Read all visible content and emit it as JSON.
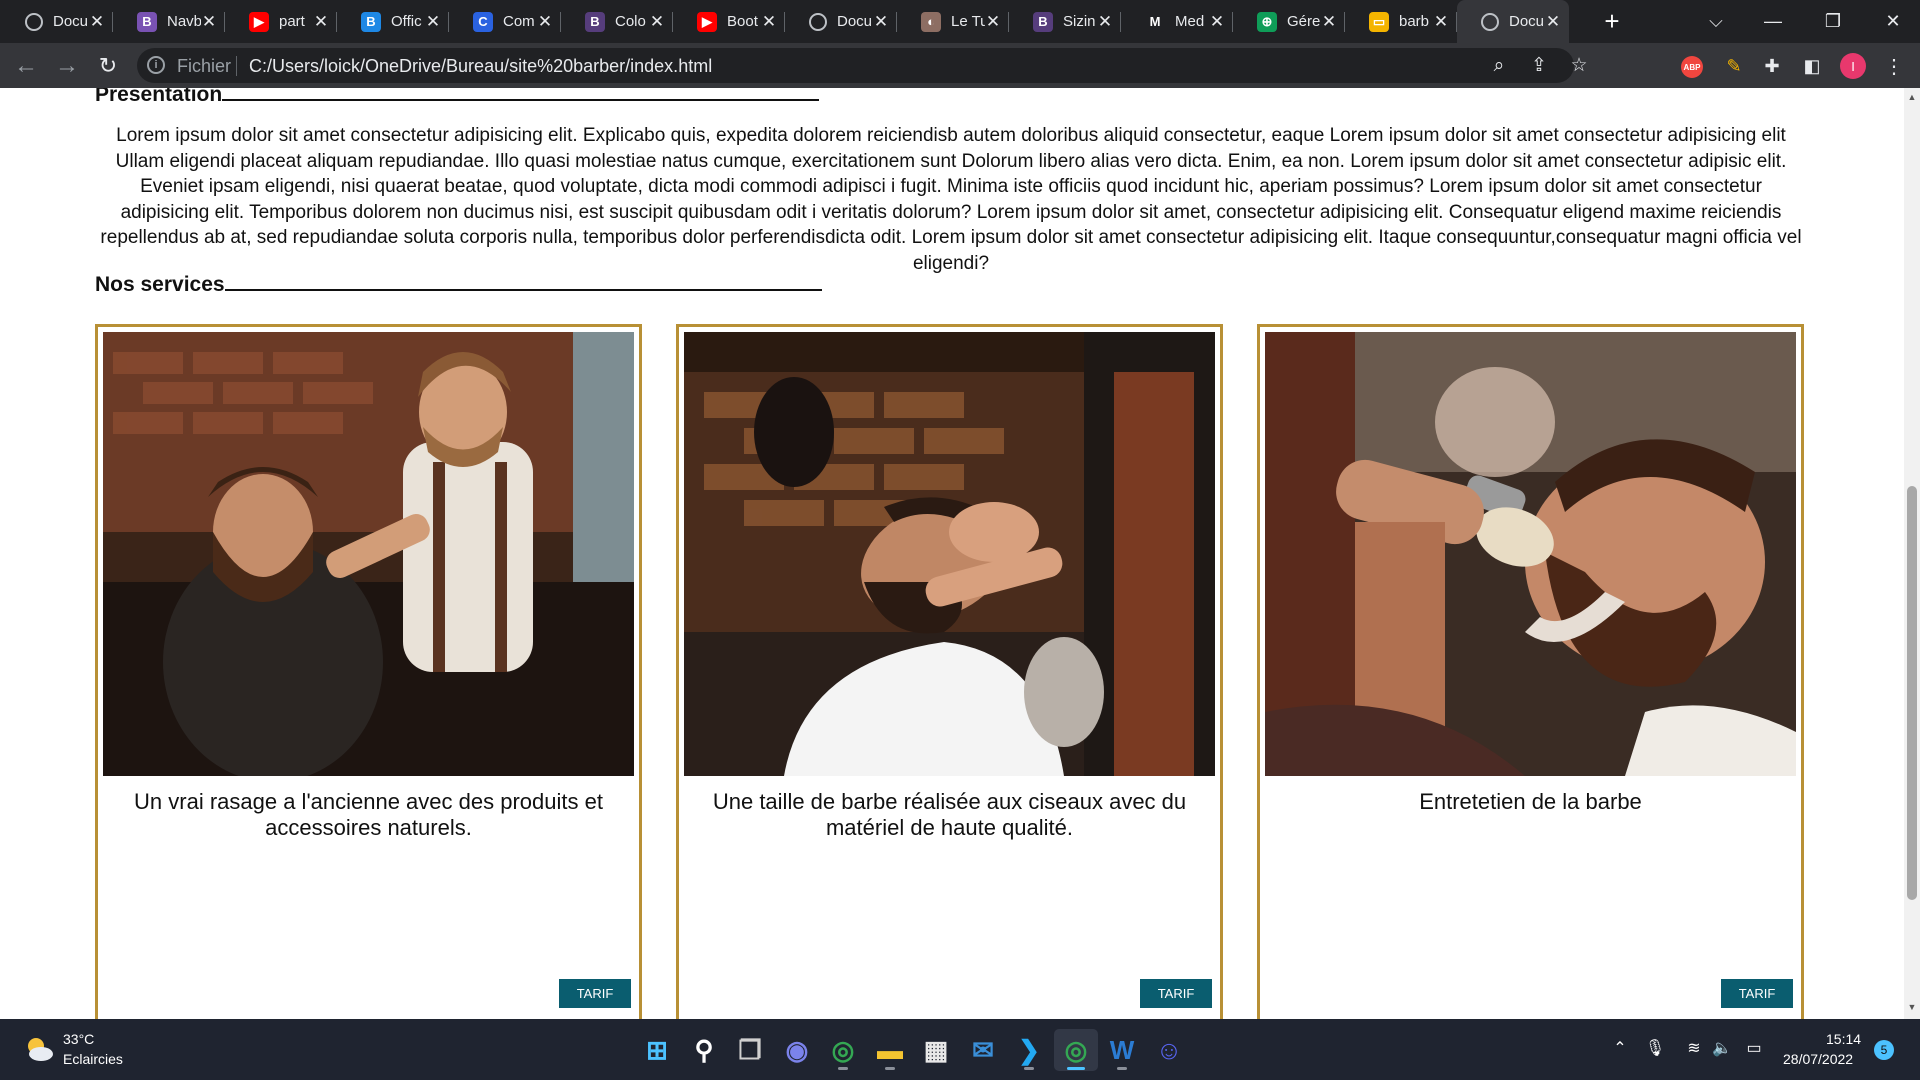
{
  "browser": {
    "tabs": [
      {
        "title": "Docu",
        "icon": "globe-icon",
        "color": "#5f6368",
        "glyph": ""
      },
      {
        "title": "Navb",
        "icon": "bootstrap-icon",
        "color": "#7952b3",
        "glyph": "B"
      },
      {
        "title": "part",
        "icon": "youtube-icon",
        "color": "#ff0000",
        "glyph": "▶"
      },
      {
        "title": "Offic",
        "icon": "bootstrap-icon",
        "color": "#1e88e5",
        "glyph": "B"
      },
      {
        "title": "Com",
        "icon": "c-icon",
        "color": "#2a62e0",
        "glyph": "C"
      },
      {
        "title": "Colo",
        "icon": "bootstrap-icon",
        "color": "#563d7c",
        "glyph": "B"
      },
      {
        "title": "Boot",
        "icon": "youtube-icon",
        "color": "#ff0000",
        "glyph": "▶"
      },
      {
        "title": "Docu",
        "icon": "globe-icon",
        "color": "#5f6368",
        "glyph": ""
      },
      {
        "title": "Le Tu",
        "icon": "snail-icon",
        "color": "#8d6e63",
        "glyph": "◐"
      },
      {
        "title": "Sizin",
        "icon": "bootstrap-icon",
        "color": "#563d7c",
        "glyph": "B"
      },
      {
        "title": "Med",
        "icon": "m-icon",
        "color": "#202124",
        "glyph": "M"
      },
      {
        "title": "Gére",
        "icon": "green-globe-icon",
        "color": "#0f9d58",
        "glyph": "⊕"
      },
      {
        "title": "barb",
        "icon": "slides-icon",
        "color": "#f4b400",
        "glyph": "▭"
      },
      {
        "title": "Docu",
        "icon": "globe-icon",
        "color": "#5f6368",
        "glyph": "",
        "active": true
      }
    ],
    "new_tab": "+",
    "address": {
      "scheme_label": "Fichier",
      "url": "C:/Users/loick/OneDrive/Bureau/site%20barber/index.html"
    },
    "extensions": {
      "abp_label": "ABP",
      "profile_initial": "I"
    }
  },
  "page": {
    "presentation": {
      "title": "Presentation",
      "text": "Lorem ipsum dolor sit amet consectetur adipisicing elit. Explicabo quis, expedita dolorem reiciendisb autem doloribus aliquid consectetur, eaque Lorem ipsum dolor sit amet consectetur adipisicing elit Ullam eligendi placeat aliquam repudiandae. Illo quasi molestiae natus cumque, exercitationem sunt Dolorum libero alias vero dicta. Enim, ea non. Lorem ipsum dolor sit amet consectetur adipisic elit. Eveniet ipsam eligendi, nisi quaerat beatae, quod voluptate, dicta modi commodi adipisci i fugit. Minima iste officiis quod incidunt hic, aperiam possimus? Lorem ipsum dolor sit amet consectetur adipisicing elit. Temporibus dolorem non ducimus nisi, est suscipit quibusdam odit i veritatis dolorum? Lorem ipsum dolor sit amet, consectetur adipisicing elit. Consequatur eligend maxime reiciendis repellendus ab at, sed repudiandae soluta corporis nulla, temporibus dolor perferendisdicta odit. Lorem ipsum dolor sit amet consectetur adipisicing elit. Itaque consequuntur,consequatur magni officia vel eligendi?"
    },
    "services": {
      "title": "Nos services",
      "cards": [
        {
          "caption": "Un vrai rasage a l'ancienne avec des produits et accessoires naturels.",
          "button": "TARIF"
        },
        {
          "caption": "Une taille de barbe réalisée aux ciseaux avec du matériel de haute qualité.",
          "button": "TARIF"
        },
        {
          "caption": "Entretetien de la barbe",
          "button": "TARIF"
        }
      ]
    },
    "accent_color": "#b89035",
    "button_color": "#0a5d6f"
  },
  "taskbar": {
    "weather": {
      "temp": "33°C",
      "desc": "Eclaircies"
    },
    "apps": [
      "windows-start-icon",
      "search-icon",
      "task-view-icon",
      "teams-icon",
      "chrome-icon",
      "file-explorer-icon",
      "store-icon",
      "mail-icon",
      "vscode-icon",
      "chrome-icon",
      "word-icon",
      "discord-icon"
    ],
    "clock": {
      "time": "15:14",
      "date": "28/07/2022"
    },
    "notifications": "5"
  }
}
